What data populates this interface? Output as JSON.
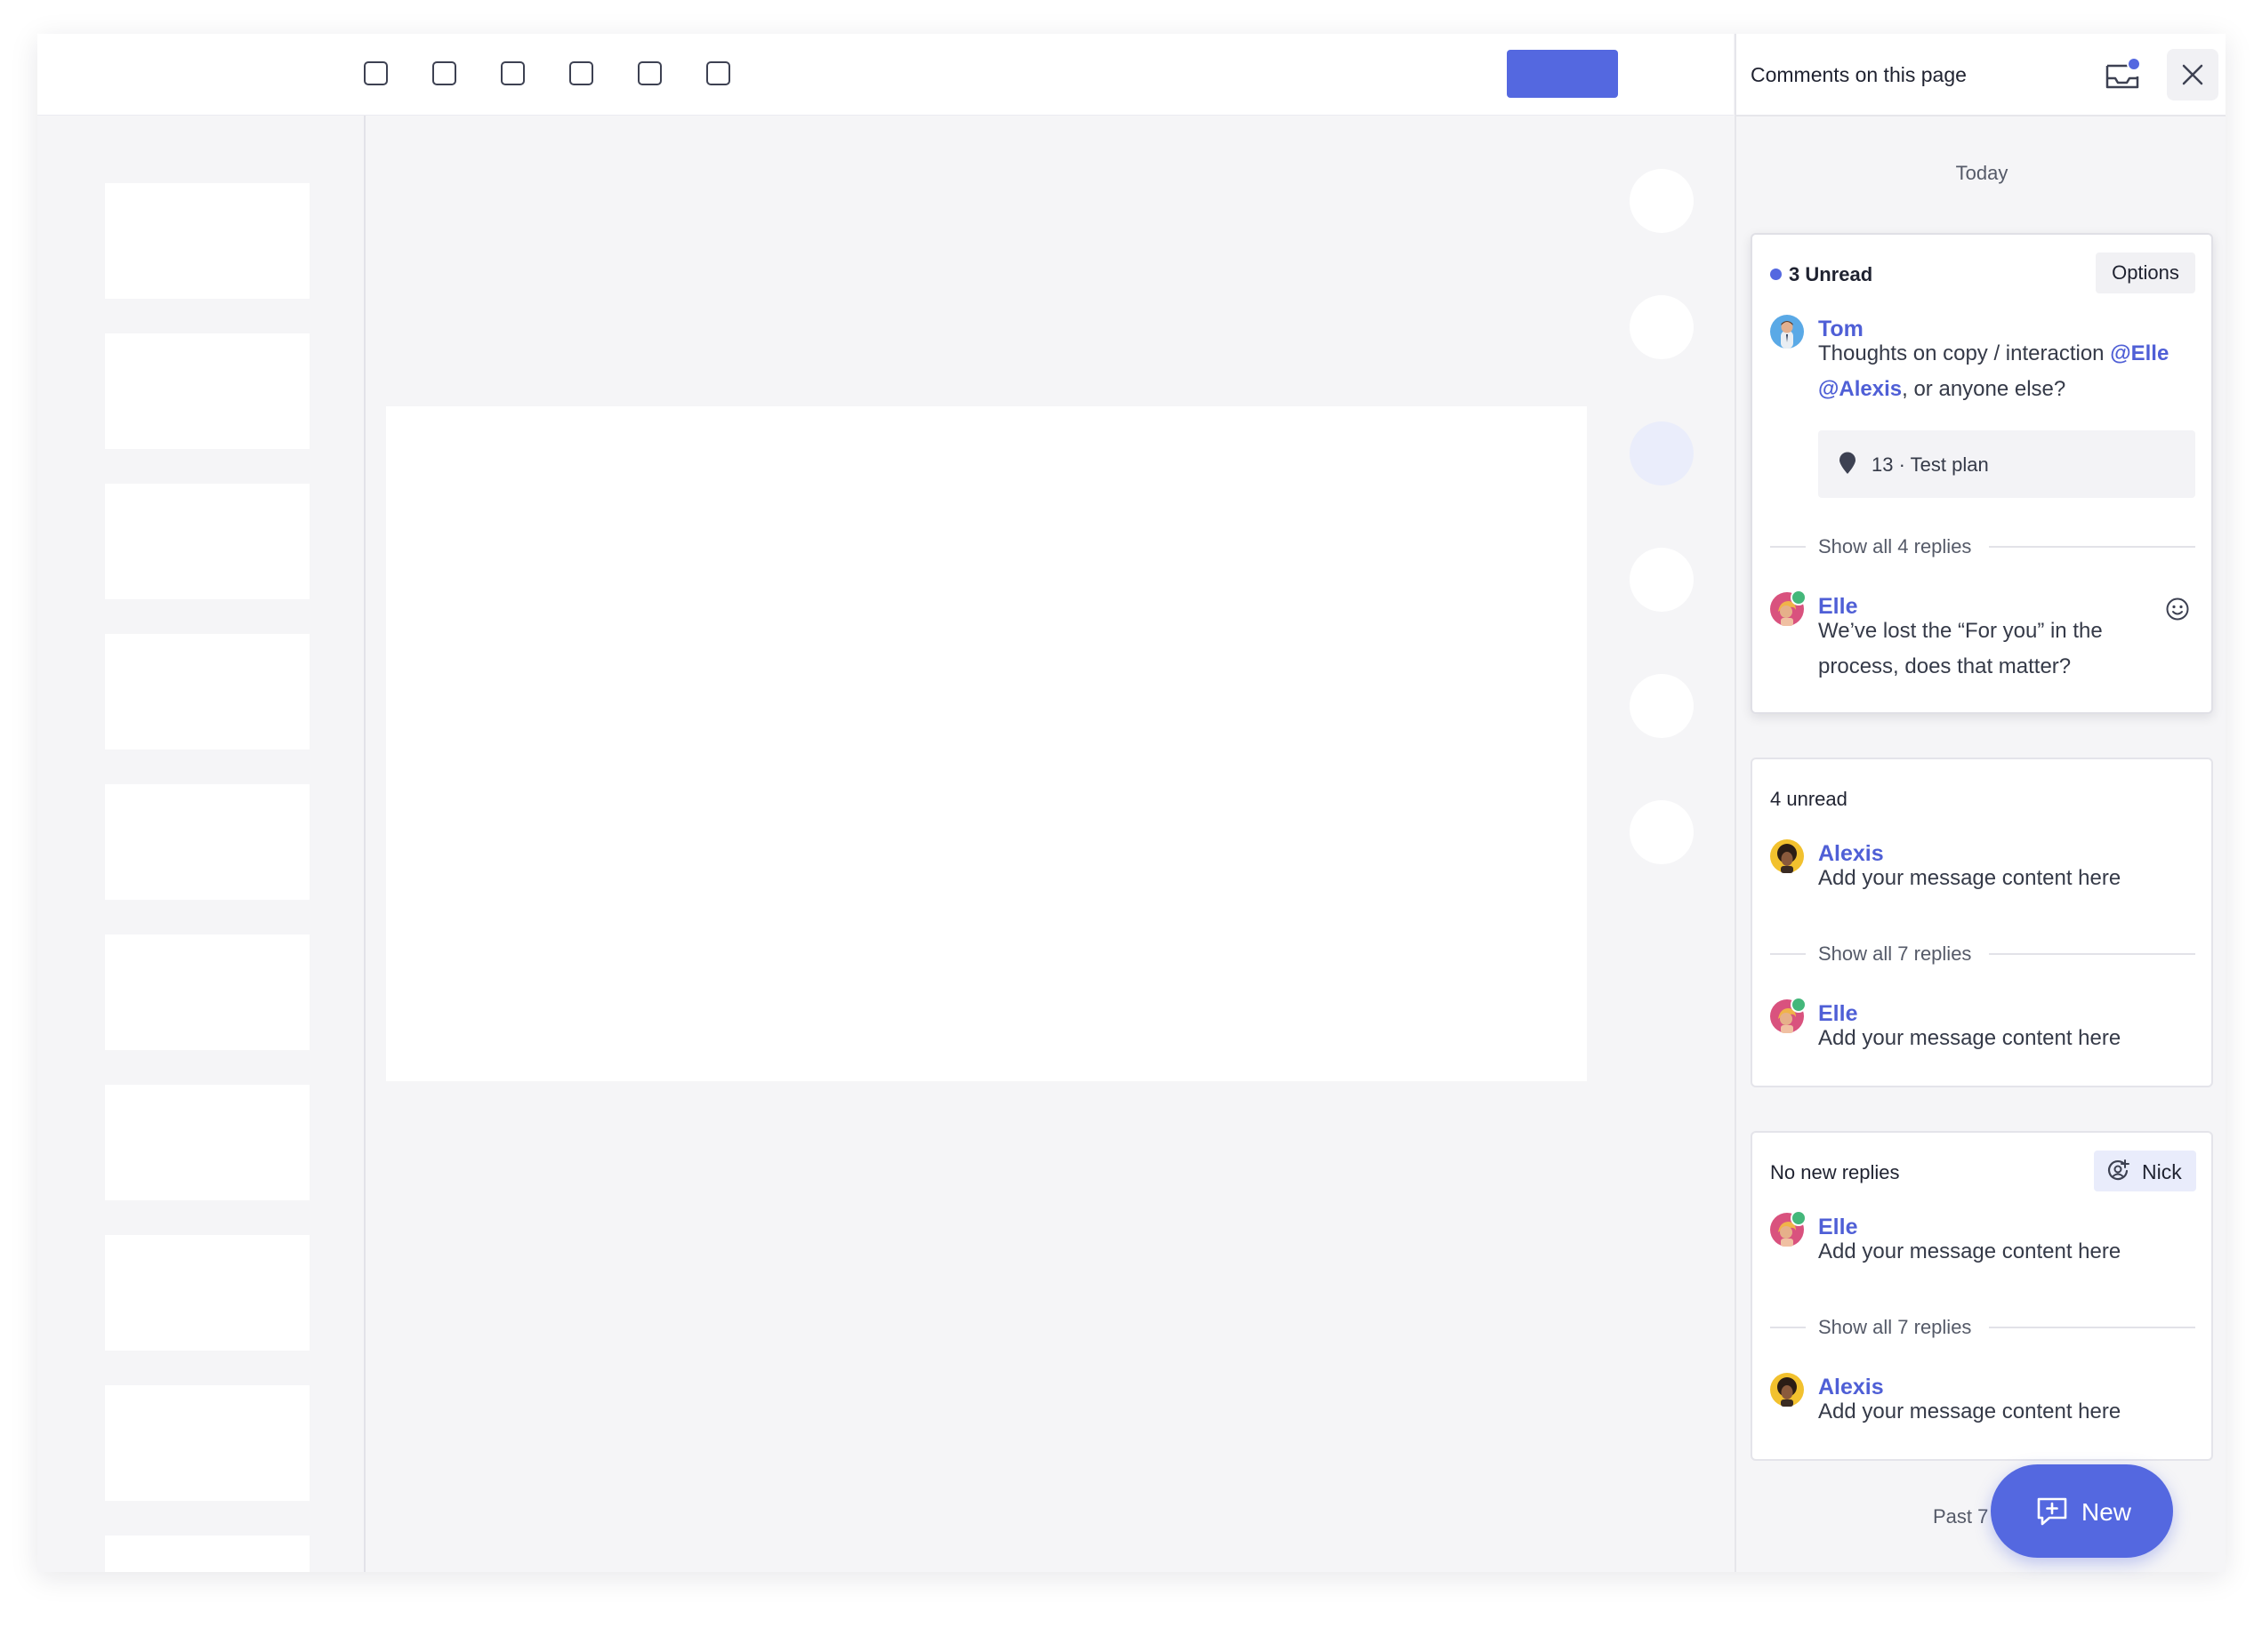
{
  "panel": {
    "title": "Comments on this page",
    "sections": {
      "today": "Today",
      "past": "Past 7 days"
    },
    "threads": [
      {
        "status": "3 Unread",
        "options_label": "Options",
        "first": {
          "author": "Tom",
          "text_before": "Thoughts on copy / interaction ",
          "mention_1": "@Elle",
          "mention_2": "@Alexis",
          "text_after": ", or anyone else?"
        },
        "pin": "13 · Test plan",
        "replies_label": "Show all 4 replies",
        "last": {
          "author": "Elle",
          "text": "We’ve lost the “For you” in the process, does that matter?"
        }
      },
      {
        "status": "4 unread",
        "first": {
          "author": "Alexis",
          "text": "Add your message content here"
        },
        "replies_label": "Show all 7 replies",
        "last": {
          "author": "Elle",
          "text": "Add your message content here"
        }
      },
      {
        "status": "No new replies",
        "assignee": "Nick",
        "first": {
          "author": "Elle",
          "text": "Add your message content here"
        },
        "replies_label": "Show all 7 replies",
        "last": {
          "author": "Alexis",
          "text": "Add your message content here"
        }
      }
    ],
    "new_button_label": "New"
  },
  "colors": {
    "accent": "#5468e0",
    "link": "#4f5fd6",
    "presence": "#44b77a"
  },
  "icons": {
    "inbox": "inbox-notification-icon",
    "close": "close-icon",
    "pin": "map-pin-icon",
    "emoji": "smiley-icon",
    "assignee": "assign-user-icon",
    "new_comment": "add-comment-icon"
  }
}
